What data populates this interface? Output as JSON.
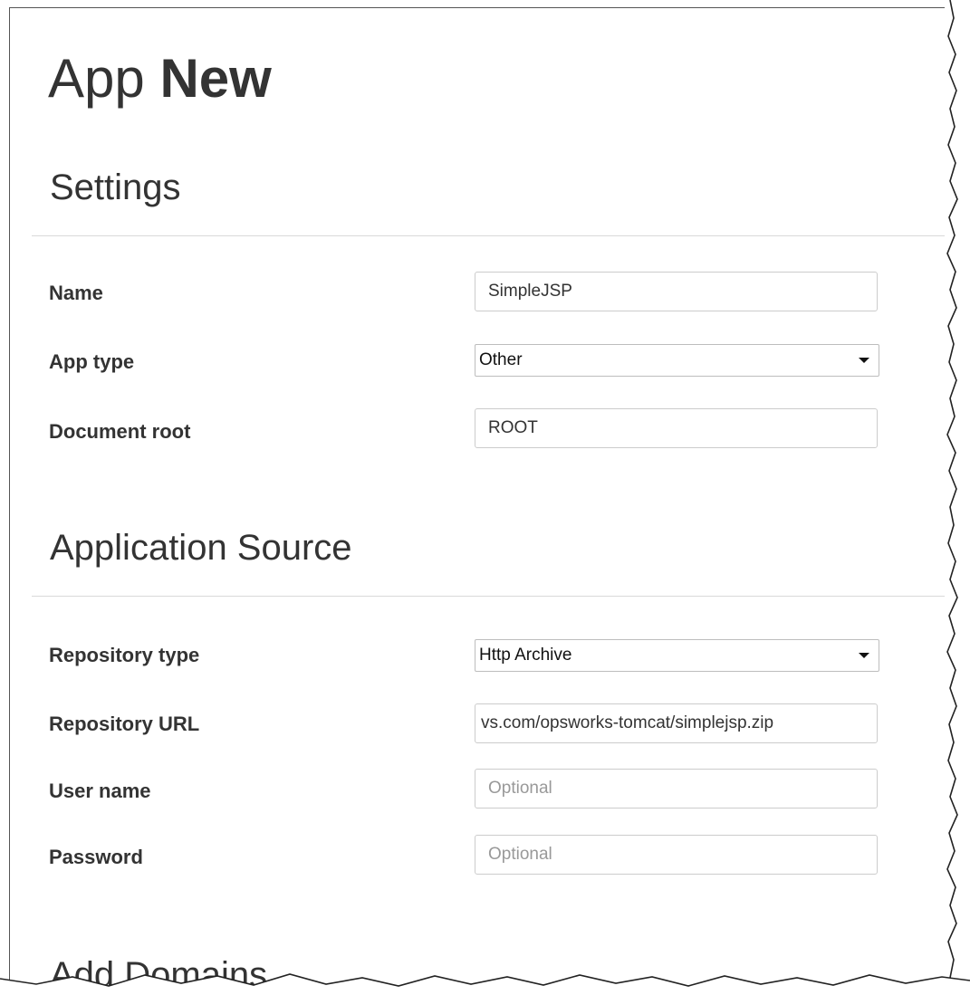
{
  "page": {
    "title_light": "App",
    "title_bold": "New"
  },
  "settings": {
    "heading": "Settings",
    "name": {
      "label": "Name",
      "value": "SimpleJSP"
    },
    "app_type": {
      "label": "App type",
      "value": "Other"
    },
    "document_root": {
      "label": "Document root",
      "value": "ROOT"
    }
  },
  "source": {
    "heading": "Application Source",
    "repository_type": {
      "label": "Repository type",
      "value": "Http Archive"
    },
    "repository_url": {
      "label": "Repository URL",
      "value": "vs.com/opsworks-tomcat/simplejsp.zip"
    },
    "user_name": {
      "label": "User name",
      "placeholder": "Optional"
    },
    "password": {
      "label": "Password",
      "placeholder": "Optional"
    }
  },
  "domains": {
    "heading": "Add Domains"
  },
  "colors": {
    "text": "#333333",
    "border": "#cccccc",
    "placeholder": "#999999"
  }
}
